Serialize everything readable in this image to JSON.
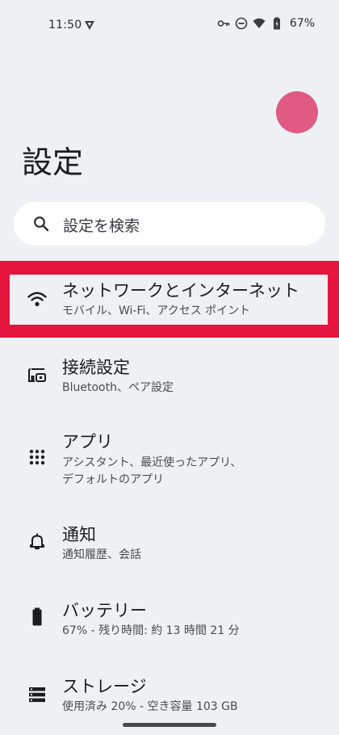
{
  "status_bar": {
    "time": "11:50",
    "battery": "67%"
  },
  "page": {
    "title": "設定"
  },
  "search": {
    "placeholder": "設定を検索"
  },
  "settings_items": [
    {
      "title": "ネットワークとインターネット",
      "subtitle": "モバイル、Wi-Fi、アクセス ポイント",
      "icon": "wifi-icon",
      "highlighted": true
    },
    {
      "title": "接続設定",
      "subtitle": "Bluetooth、ペア設定",
      "icon": "connected-devices-icon"
    },
    {
      "title": "アプリ",
      "subtitle": "アシスタント、最近使ったアプリ、\nデフォルトのアプリ",
      "icon": "apps-grid-icon"
    },
    {
      "title": "通知",
      "subtitle": "通知履歴、会話",
      "icon": "bell-icon"
    },
    {
      "title": "バッテリー",
      "subtitle": "67% - 残り時間: 約 13 時間 21 分",
      "icon": "battery-icon"
    },
    {
      "title": "ストレージ",
      "subtitle": "使用済み 20% - 空き容量 103 GB",
      "icon": "storage-icon"
    }
  ],
  "colors": {
    "background": "#eef0f4",
    "highlight": "#e6153d",
    "avatar": "#df5b83"
  }
}
